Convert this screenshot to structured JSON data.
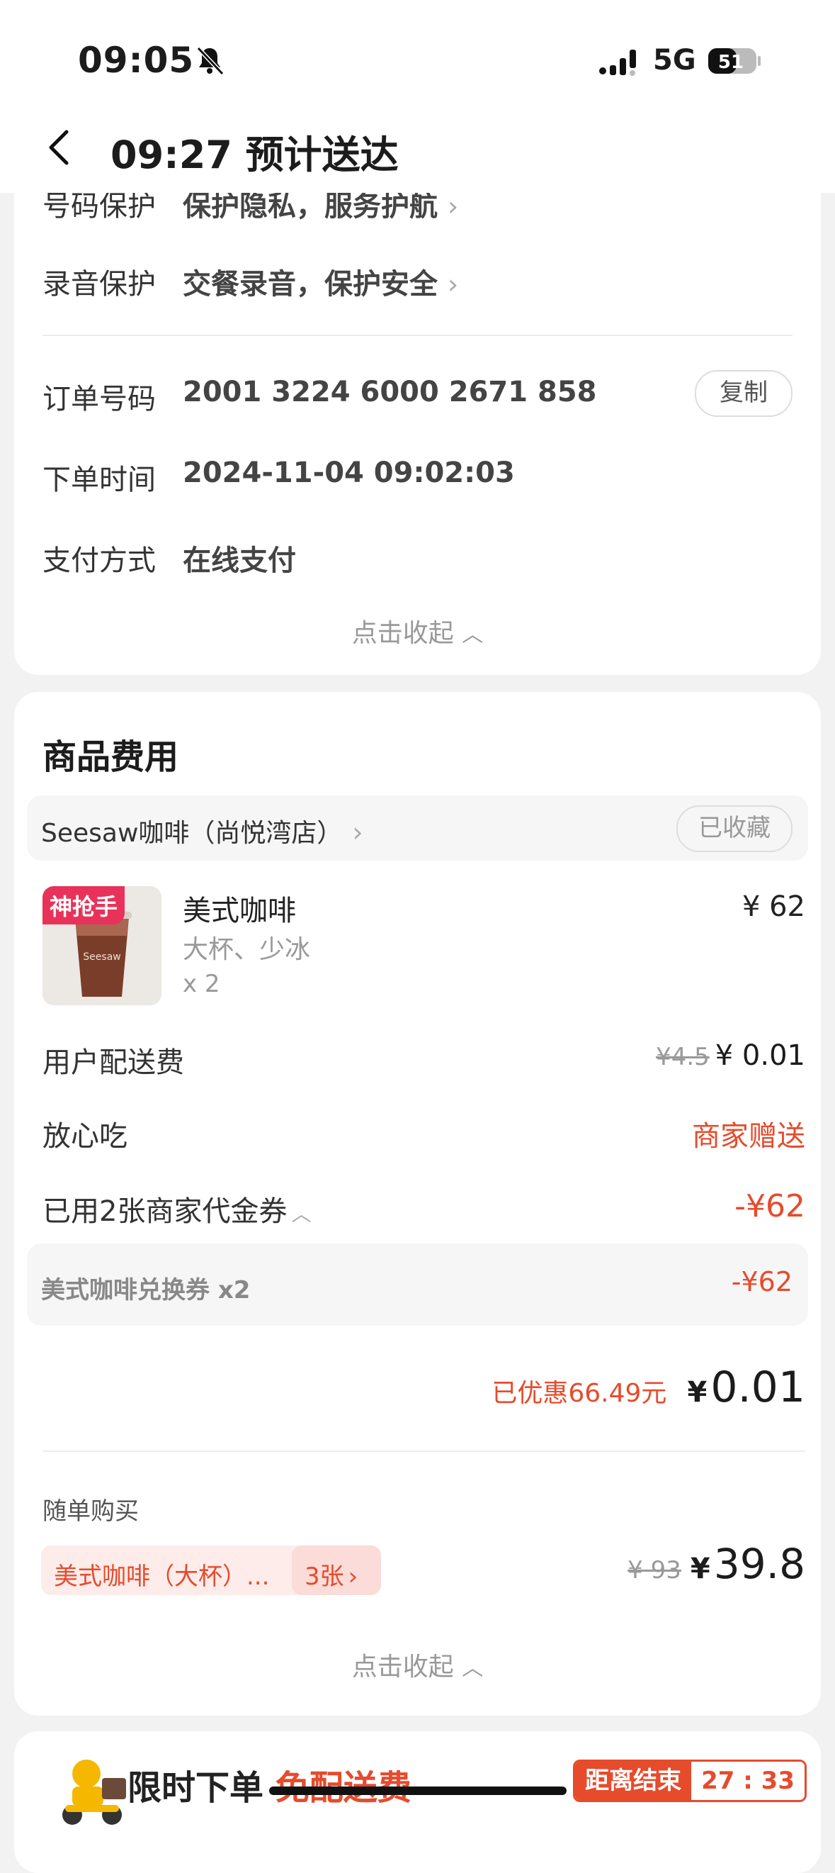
{
  "status_bar": {
    "time": "09:05",
    "network": "5G",
    "battery": "51"
  },
  "header": {
    "title": "09:27 预计送达"
  },
  "order_info": {
    "privacy_label": "号码保护",
    "privacy_value": "保护隐私，服务护航",
    "recording_label": "录音保护",
    "recording_value": "交餐录音，保护安全",
    "order_no_label": "订单号码",
    "order_no_value": "2001 3224 6000 2671 858",
    "copy_label": "复制",
    "time_label": "下单时间",
    "time_value": "2024-11-04 09:02:03",
    "pay_label": "支付方式",
    "pay_value": "在线支付",
    "collapse_label": "点击收起"
  },
  "fees": {
    "section_title": "商品费用",
    "shop_name": "Seesaw咖啡（尚悦湾店）",
    "fav_label": "已收藏",
    "product": {
      "badge": "神抢手",
      "name": "美式咖啡",
      "spec": "大杯、少冰",
      "qty": "x 2",
      "price": "¥ 62"
    },
    "delivery_label": "用户配送费",
    "delivery_original": "¥4.5",
    "delivery_price": "¥ 0.01",
    "safe_label": "放心吃",
    "safe_value": "商家赠送",
    "voucher_label": "已用2张商家代金券",
    "voucher_value": "-¥62",
    "voucher_detail_label": "美式咖啡兑换券 x2",
    "voucher_detail_value": "-¥62",
    "saved_text": "已优惠66.49元",
    "total_yen": "¥",
    "total_amount": "0.01",
    "addon_title": "随单购买",
    "addon_item": "美式咖啡（大杯）...",
    "addon_count": "3张",
    "addon_original": "¥ 93",
    "addon_yen": "¥",
    "addon_amount": "39.8",
    "collapse_label": "点击收起"
  },
  "promo": {
    "text_a": "限时下单",
    "text_b": "免配送费",
    "countdown_label": "距离结束",
    "countdown_time": "27 : 33"
  },
  "colors": {
    "accent": "#e64b2c",
    "badge": "#e8325a"
  }
}
